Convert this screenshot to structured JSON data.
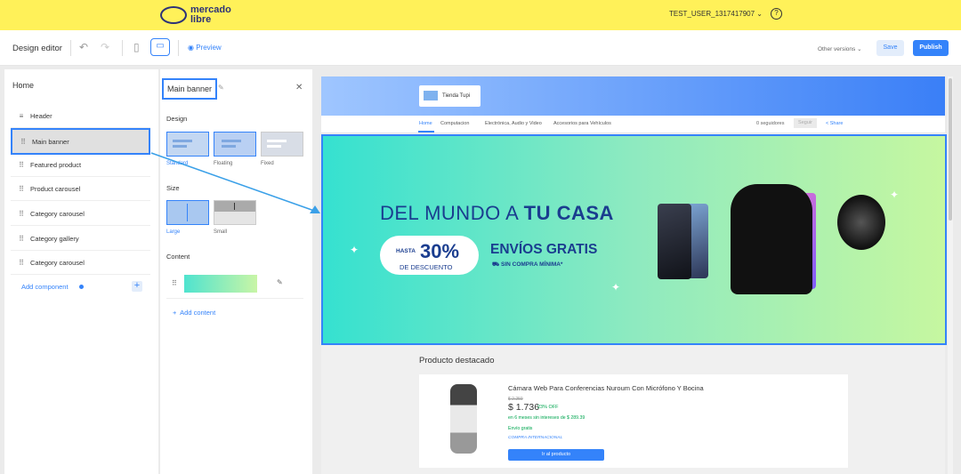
{
  "topbar": {
    "logo_text": "mercado\nlibre",
    "logo_line1": "mercado",
    "logo_line2": "libre",
    "user": "TEST_USER_1317417907",
    "help_icon": "?"
  },
  "toolbar": {
    "title": "Design editor",
    "undo_icon": "↶",
    "redo_icon": "↷",
    "mobile_icon": "▯",
    "desktop_icon": "▭",
    "preview_label": "Preview",
    "preview_icon": "◉",
    "other_versions": "Other versions",
    "save": "Save",
    "publish": "Publish"
  },
  "sidebar": {
    "title": "Home",
    "items": [
      {
        "label": "Header",
        "icon": "≡"
      },
      {
        "label": "Main banner",
        "icon": "⠿"
      },
      {
        "label": "Featured product",
        "icon": "⠿"
      },
      {
        "label": "Product carousel",
        "icon": "⠿"
      },
      {
        "label": "Category carousel",
        "icon": "⠿"
      },
      {
        "label": "Category gallery",
        "icon": "⠿"
      },
      {
        "label": "Category carousel",
        "icon": "⠿"
      }
    ],
    "add_component": "Add component",
    "add_plus": "+"
  },
  "panel": {
    "title": "Main banner",
    "edit_icon": "✎",
    "close_icon": "✕",
    "design_label": "Design",
    "design_options": [
      "Standard",
      "Floating",
      "Fixed"
    ],
    "size_label": "Size",
    "size_options": [
      "Large",
      "Small"
    ],
    "content_label": "Content",
    "content_grip": "⠿",
    "content_edit_icon": "✎",
    "add_content": "Add content",
    "add_content_icon": "+"
  },
  "preview": {
    "store_name": "Tienda Tupi",
    "nav": [
      "Home",
      "Computacion",
      "Electrónica, Audio y Video",
      "Accesorios para Vehículos"
    ],
    "followers": "0 seguidores",
    "follow_btn": "Seguir",
    "share": "Share",
    "banner": {
      "headline_a": "DEL MUNDO A ",
      "headline_b": "TU CASA",
      "hasta": "HASTA",
      "percent": "30%",
      "descuento": "DE DESCUENTO",
      "envios": "ENVÍOS GRATIS",
      "sin_compra": "SIN COMPRA MÍNIMA*"
    },
    "featured_label": "Producto destacado",
    "product": {
      "title": "Cámara Web Para Conferencias Nuroum Con Micrófono Y Bocina",
      "old_price": "$ 2.259",
      "price": "$ 1.736",
      "off": "23% OFF",
      "installments": "en 6 meses sin intereses de $ 289.39",
      "shipping": "Envío gratis",
      "international": "COMPRA INTERNACIONAL",
      "button": "Ir al producto"
    }
  },
  "colors": {
    "brand_yellow": "#fff159",
    "accent_blue": "#3483fa",
    "banner_text": "#1a3d8f"
  }
}
